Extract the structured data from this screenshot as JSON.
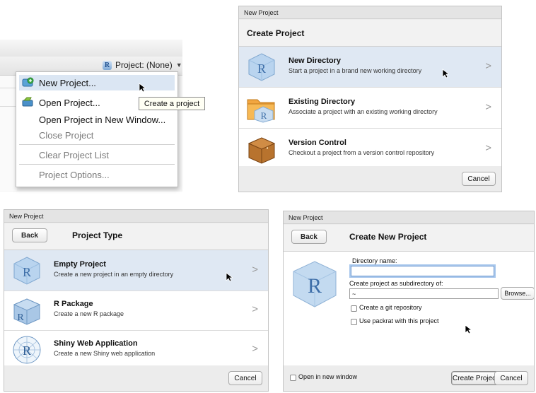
{
  "panel1": {
    "project_button_label": "Project: (None)",
    "menu": {
      "new_project": "New Project...",
      "open_project": "Open Project...",
      "open_project_new_window": "Open Project in New Window...",
      "close_project": "Close Project",
      "clear_project_list": "Clear Project List",
      "project_options": "Project Options..."
    },
    "tooltip": "Create a project"
  },
  "panel2": {
    "window_title": "New Project",
    "heading": "Create Project",
    "options": [
      {
        "title": "New Directory",
        "subtitle": "Start a project in a brand new working directory",
        "icon": "r-cube-icon"
      },
      {
        "title": "Existing Directory",
        "subtitle": "Associate a project with an existing working directory",
        "icon": "folder-r-icon"
      },
      {
        "title": "Version Control",
        "subtitle": "Checkout a project from a version control repository",
        "icon": "box-icon"
      }
    ],
    "cancel": "Cancel",
    "chevron": ">"
  },
  "panel3": {
    "window_title": "New Project",
    "back": "Back",
    "heading": "Project Type",
    "options": [
      {
        "title": "Empty Project",
        "subtitle": "Create a new project in an empty directory",
        "icon": "r-cube-icon"
      },
      {
        "title": "R Package",
        "subtitle": "Create a new R package",
        "icon": "r-package-icon"
      },
      {
        "title": "Shiny Web Application",
        "subtitle": "Create a new Shiny web application",
        "icon": "shiny-globe-icon"
      }
    ],
    "cancel": "Cancel",
    "chevron": ">"
  },
  "panel4": {
    "window_title": "New Project",
    "back": "Back",
    "heading": "Create New Project",
    "directory_name_label": "Directory name:",
    "directory_name_value": "",
    "subdirectory_label": "Create project as subdirectory of:",
    "subdirectory_value": "~",
    "browse": "Browse...",
    "git_checkbox_label": "Create a git repository",
    "packrat_checkbox_label": "Use packrat with this project",
    "open_new_window_label": "Open in new window",
    "create_button": "Create Project",
    "cancel": "Cancel"
  },
  "colors": {
    "selection": "#dfe8f3",
    "menu_highlight": "#dbe6f3",
    "dialog_bg": "#ececec"
  }
}
